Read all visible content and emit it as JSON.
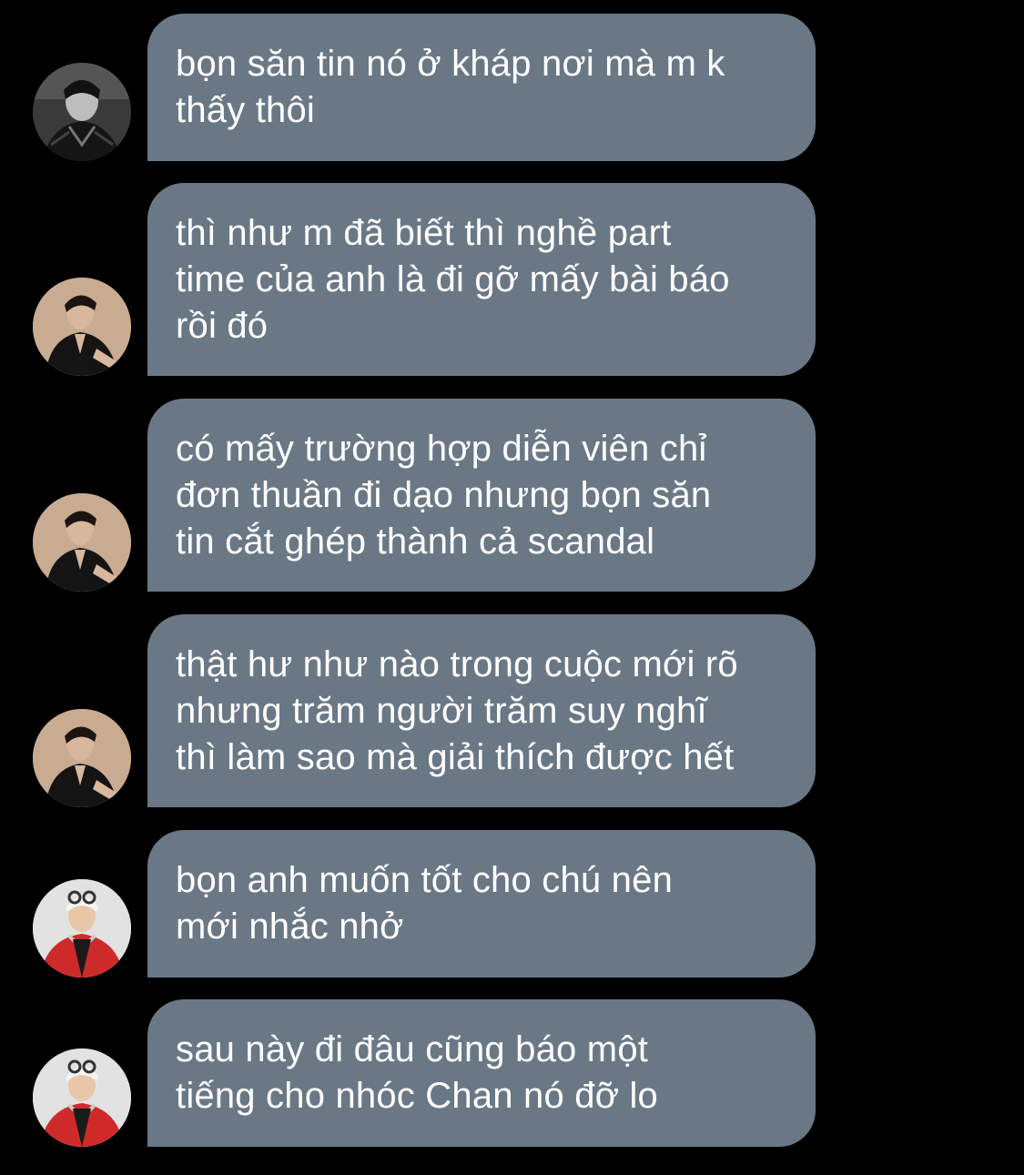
{
  "messages": [
    {
      "text": "bọn săn tin nó ở kháp nơi mà m k\nthấy thôi",
      "avatar": "avatar-monochrome-jacket"
    },
    {
      "text": "thì như m đã biết thì nghề part\ntime của anh là đi gỡ mấy bài báo\nrồi đó",
      "avatar": "avatar-black-suit"
    },
    {
      "text": "có mấy trường hợp diễn viên chỉ\nđơn thuần đi dạo nhưng bọn săn\ntin cắt ghép thành cả scandal",
      "avatar": "avatar-black-suit"
    },
    {
      "text": "thật hư như nào trong cuộc mới rõ\nnhưng trăm người trăm suy nghĩ\nthì làm sao mà giải thích được hết",
      "avatar": "avatar-black-suit"
    },
    {
      "text": "bọn anh muốn tốt cho chú nên\nmới nhắc nhở",
      "avatar": "avatar-red-jacket"
    },
    {
      "text": "sau này đi đâu cũng báo một\ntiếng cho nhóc Chan nó đỡ lo",
      "avatar": "avatar-red-jacket"
    }
  ],
  "colors": {
    "background": "#000000",
    "bubble": "#6a7886",
    "text": "#ffffff"
  }
}
